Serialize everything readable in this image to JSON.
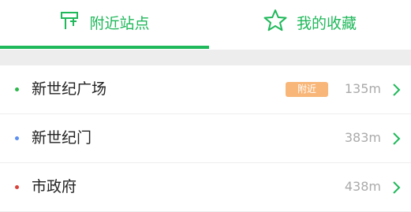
{
  "tabs": {
    "nearby": {
      "label": "附近站点",
      "icon": "bus-stop-sign-icon"
    },
    "favorites": {
      "label": "我的收藏",
      "icon": "star-outline-icon"
    }
  },
  "colors": {
    "accent": "#1fb85a",
    "badge": "#f8b678"
  },
  "stations": [
    {
      "name": "新世纪广场",
      "badge": "附近",
      "distance": "135m",
      "dot_color": "#2db84c"
    },
    {
      "name": "新世纪门",
      "distance": "383m",
      "dot_color": "#5b8ff0"
    },
    {
      "name": "市政府",
      "distance": "438m",
      "dot_color": "#d9423a"
    }
  ]
}
